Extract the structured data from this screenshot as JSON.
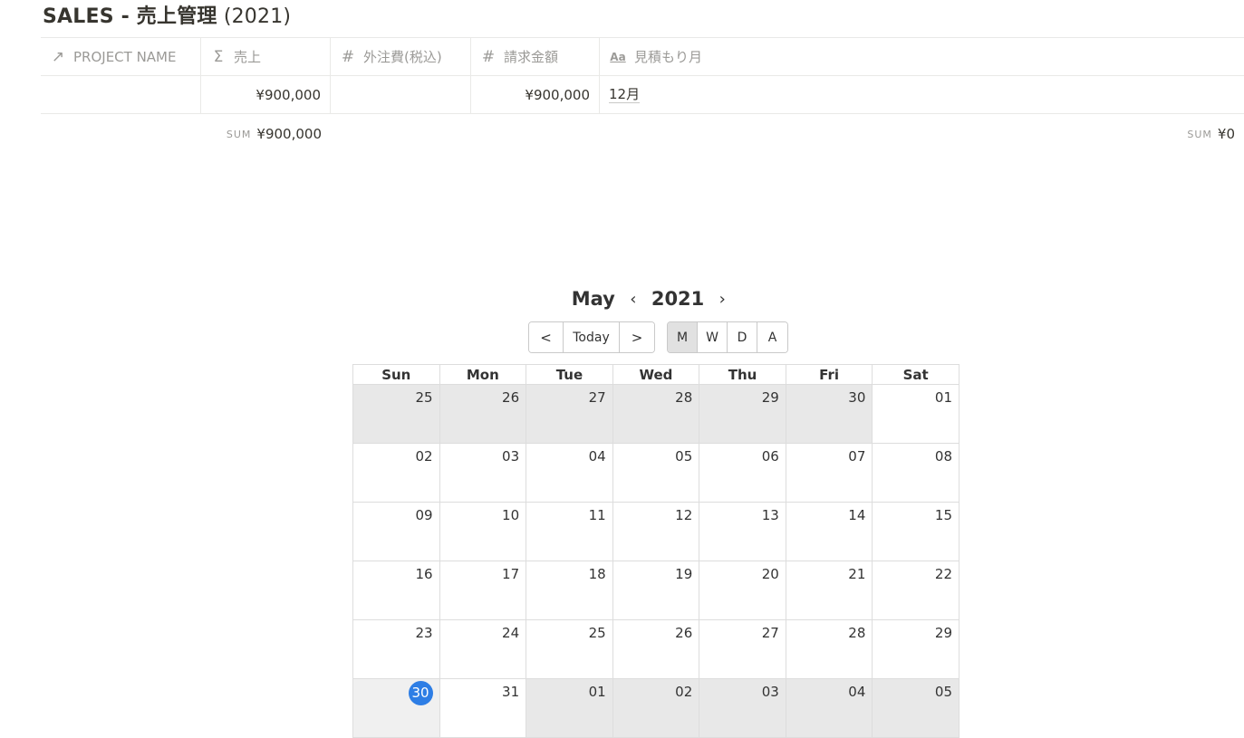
{
  "page": {
    "title_main": "SALES - 売上管理",
    "title_year": " (2021)"
  },
  "table": {
    "columns": [
      {
        "icon": "arrow-up-right-icon",
        "glyph": "↗",
        "label": "PROJECT NAME"
      },
      {
        "icon": "sigma-icon",
        "glyph": "Σ",
        "label": "売上"
      },
      {
        "icon": "hash-icon",
        "glyph": "#",
        "label": "外注費(税込)"
      },
      {
        "icon": "hash-icon",
        "glyph": "#",
        "label": "請求金額"
      },
      {
        "icon": "text-aa-icon",
        "glyph": "Aa",
        "label": "見積もり月"
      }
    ],
    "rows": [
      {
        "project_name": "",
        "sales": "¥900,000",
        "outsourcing": "",
        "billing": "¥900,000",
        "month": "12月"
      }
    ],
    "sums": {
      "sales_label": "SUM",
      "sales_value": "¥900,000",
      "outsourcing_label": "SUM",
      "outsourcing_value": "¥0"
    }
  },
  "calendar": {
    "month": "May",
    "year": "2021",
    "prev_glyph": "‹",
    "next_glyph": "›",
    "toolbar": {
      "prev": "<",
      "today": "Today",
      "next": ">",
      "views": [
        "M",
        "W",
        "D",
        "A"
      ],
      "active_view": "M"
    },
    "weekdays": [
      "Sun",
      "Mon",
      "Tue",
      "Wed",
      "Thu",
      "Fri",
      "Sat"
    ],
    "weeks": [
      [
        "25",
        "26",
        "27",
        "28",
        "29",
        "30",
        "01"
      ],
      [
        "02",
        "03",
        "04",
        "05",
        "06",
        "07",
        "08"
      ],
      [
        "09",
        "10",
        "11",
        "12",
        "13",
        "14",
        "15"
      ],
      [
        "16",
        "17",
        "18",
        "19",
        "20",
        "21",
        "22"
      ],
      [
        "23",
        "24",
        "25",
        "26",
        "27",
        "28",
        "29"
      ],
      [
        "30",
        "31",
        "01",
        "02",
        "03",
        "04",
        "05"
      ]
    ],
    "today": "30",
    "colors": {
      "today_badge": "#2e7ee5",
      "other_month": "#e8e8e8",
      "active_view": "#e1e1e1"
    }
  }
}
